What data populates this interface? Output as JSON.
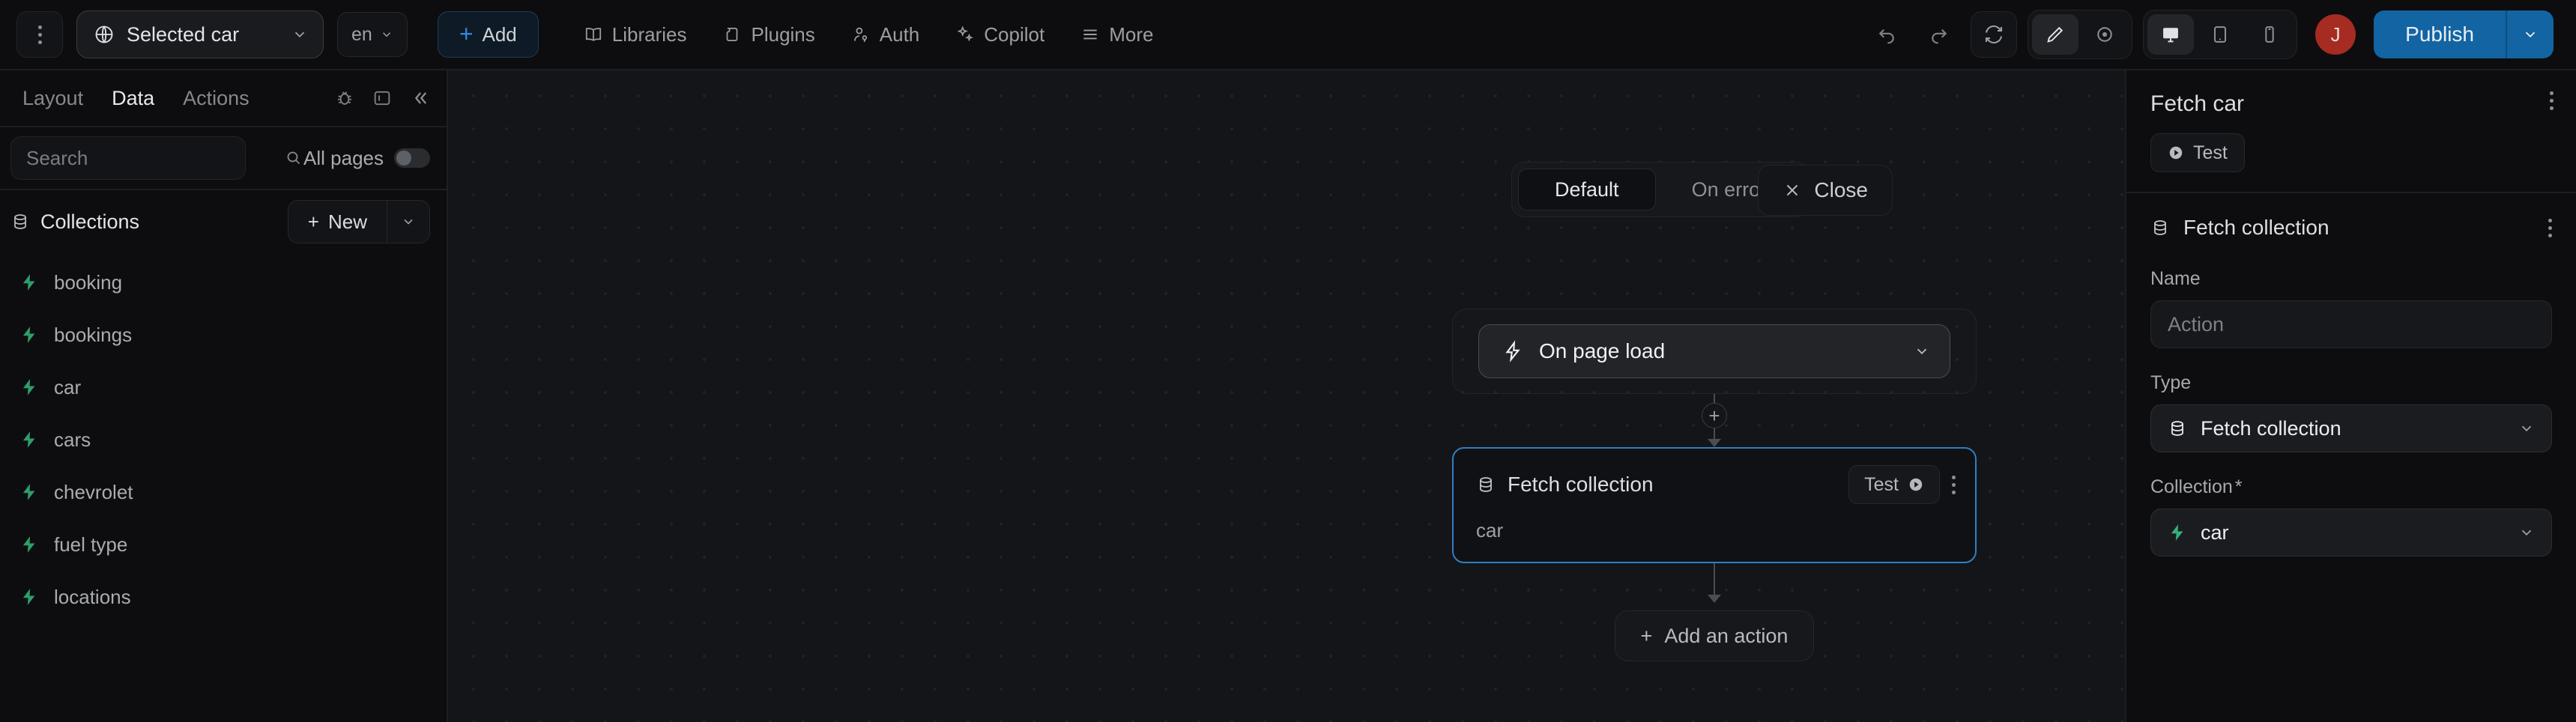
{
  "toolbar": {
    "menu_icon": "kebab-menu-icon",
    "page_selector": {
      "icon": "globe-icon",
      "label": "Selected car",
      "caret": "chevron-down-icon"
    },
    "language": {
      "label": "en",
      "caret": "chevron-down-icon"
    },
    "add_button": {
      "plus": "+",
      "label": "Add"
    },
    "nav": [
      {
        "icon": "book-icon",
        "label": "Libraries"
      },
      {
        "icon": "plugin-icon",
        "label": "Plugins"
      },
      {
        "icon": "user-key-icon",
        "label": "Auth"
      },
      {
        "icon": "sparkles-icon",
        "label": "Copilot"
      },
      {
        "icon": "hamburger-icon",
        "label": "More"
      }
    ],
    "history": {
      "undo": "undo-icon",
      "redo": "redo-icon",
      "refresh": "refresh-icon"
    },
    "edit_modes": [
      {
        "icon": "pencil-icon",
        "name": "edit-mode",
        "active": true
      },
      {
        "icon": "eye-icon",
        "name": "preview-mode",
        "active": false
      }
    ],
    "devices": [
      {
        "icon": "desktop-icon",
        "name": "desktop",
        "active": true
      },
      {
        "icon": "tablet-icon",
        "name": "tablet",
        "active": false
      },
      {
        "icon": "mobile-icon",
        "name": "mobile",
        "active": false
      }
    ],
    "avatar": {
      "initial": "J",
      "color": "#a62b22"
    },
    "publish": {
      "label": "Publish",
      "caret": "chevron-down-icon",
      "color": "#1264a3"
    }
  },
  "sidebar": {
    "tabs": [
      {
        "label": "Layout",
        "active": false
      },
      {
        "label": "Data",
        "active": true
      },
      {
        "label": "Actions",
        "active": false
      }
    ],
    "header_icons": [
      {
        "name": "bug-icon"
      },
      {
        "name": "panel-icon"
      },
      {
        "name": "collapse-left-icon"
      }
    ],
    "search": {
      "placeholder": "Search",
      "value": "",
      "icon": "search-icon"
    },
    "all_pages": {
      "label": "All pages",
      "enabled": false
    },
    "collections_header": {
      "icon": "database-icon",
      "title": "Collections",
      "new_label": "New",
      "new_plus": "+",
      "caret": "chevron-down-icon"
    },
    "collections": [
      {
        "label": "booking",
        "icon": "supabase-bolt-icon"
      },
      {
        "label": "bookings",
        "icon": "supabase-bolt-icon"
      },
      {
        "label": "car",
        "icon": "supabase-bolt-icon"
      },
      {
        "label": "cars",
        "icon": "supabase-bolt-icon"
      },
      {
        "label": "chevrolet",
        "icon": "supabase-bolt-icon"
      },
      {
        "label": "fuel type",
        "icon": "supabase-bolt-icon"
      },
      {
        "label": "locations",
        "icon": "supabase-bolt-icon"
      }
    ]
  },
  "canvas": {
    "modes": [
      {
        "label": "Default",
        "active": true
      },
      {
        "label": "On error",
        "active": false
      }
    ],
    "close_button": {
      "icon": "close-icon",
      "label": "Close"
    },
    "trigger_node": {
      "icon": "lightning-icon",
      "label": "On page load",
      "caret": "chevron-down-icon"
    },
    "plus_connector": "+",
    "action_node": {
      "icon": "database-icon",
      "title": "Fetch collection",
      "test_label": "Test",
      "test_icon": "play-circle-icon",
      "menu_icon": "kebab-menu-icon",
      "subtitle": "car",
      "selected": true,
      "accent": "#2f7fc4"
    },
    "add_action": {
      "plus": "+",
      "label": "Add an action"
    }
  },
  "right_panel": {
    "title": "Fetch car",
    "menu_icon": "kebab-menu-icon",
    "test": {
      "icon": "play-circle-icon",
      "label": "Test"
    },
    "section": {
      "icon": "database-icon",
      "title": "Fetch collection",
      "menu_icon": "kebab-menu-icon"
    },
    "fields": [
      {
        "label": "Name",
        "type": "input",
        "value": "",
        "placeholder": "Action",
        "required": false
      },
      {
        "label": "Type",
        "type": "select",
        "value": "Fetch collection",
        "icon": "database-icon",
        "required": false
      },
      {
        "label": "Collection",
        "type": "select",
        "value": "car",
        "icon": "supabase-bolt-icon",
        "required": true,
        "required_mark": "*"
      }
    ]
  }
}
